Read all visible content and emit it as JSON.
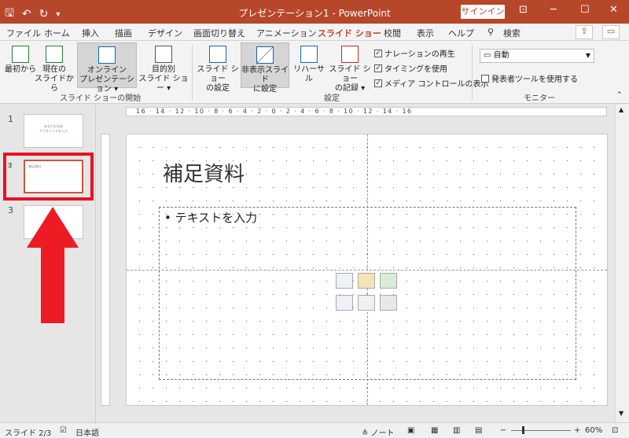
{
  "title_bar": {
    "title": "プレゼンテーション1  -  PowerPoint",
    "signin": "サインイン",
    "minimize": "─",
    "restore": "☐",
    "close": "✕",
    "ribbon_opt": "⊡"
  },
  "tabs": [
    "ファイル",
    "ホーム",
    "挿入",
    "描画",
    "デザイン",
    "画面切り替え",
    "アニメーション",
    "スライド ショー",
    "校閲",
    "表示",
    "ヘルプ",
    "検索"
  ],
  "active_tab": "スライド ショー",
  "ribbon": {
    "btn_from_beginning": "最初から",
    "btn_from_current_1": "現在の",
    "btn_from_current_2": "スライドから",
    "btn_online_1": "オンライン",
    "btn_online_2": "プレゼンテーション ▾",
    "btn_custom_1": "目的別",
    "btn_custom_2": "スライド ショー ▾",
    "group_start": "スライド ショーの開始",
    "btn_setup_1": "スライド ショー",
    "btn_setup_2": "の設定",
    "btn_hide_1": "非表示スライド",
    "btn_hide_2": "に設定",
    "btn_rehearse": "リハーサル",
    "btn_record_1": "スライド ショー",
    "btn_record_2": "の記録 ▾",
    "chk_narration": "ナレーションの再生",
    "chk_timing": "タイミングを使用",
    "chk_media": "メディア コントロールの表示",
    "group_setup": "設定",
    "monitor_value": "自動",
    "chk_presenter": "発表者ツールを使用する",
    "group_monitor": "モニター"
  },
  "thumbnails": [
    {
      "num": "1",
      "text": "あなたの名前\nサブタイトルを入力"
    },
    {
      "num": "2",
      "text": "補足資料"
    },
    {
      "num": "3",
      "text": ""
    }
  ],
  "slide": {
    "title": "補足資料",
    "bullet": "• テキストを入力"
  },
  "ruler": "16 · 14 · 12 · 10 · 8 · 6 · 4 · 2 · 0 · 2 · 4 · 6 · 8 · 10 · 12 · 14 · 16",
  "status": {
    "slide": "スライド 2/3",
    "language": "日本語",
    "notes": "≜ ノート",
    "zoom": "60%"
  },
  "colors": {
    "accent": "#b7472a",
    "highlight": "#e81123"
  }
}
